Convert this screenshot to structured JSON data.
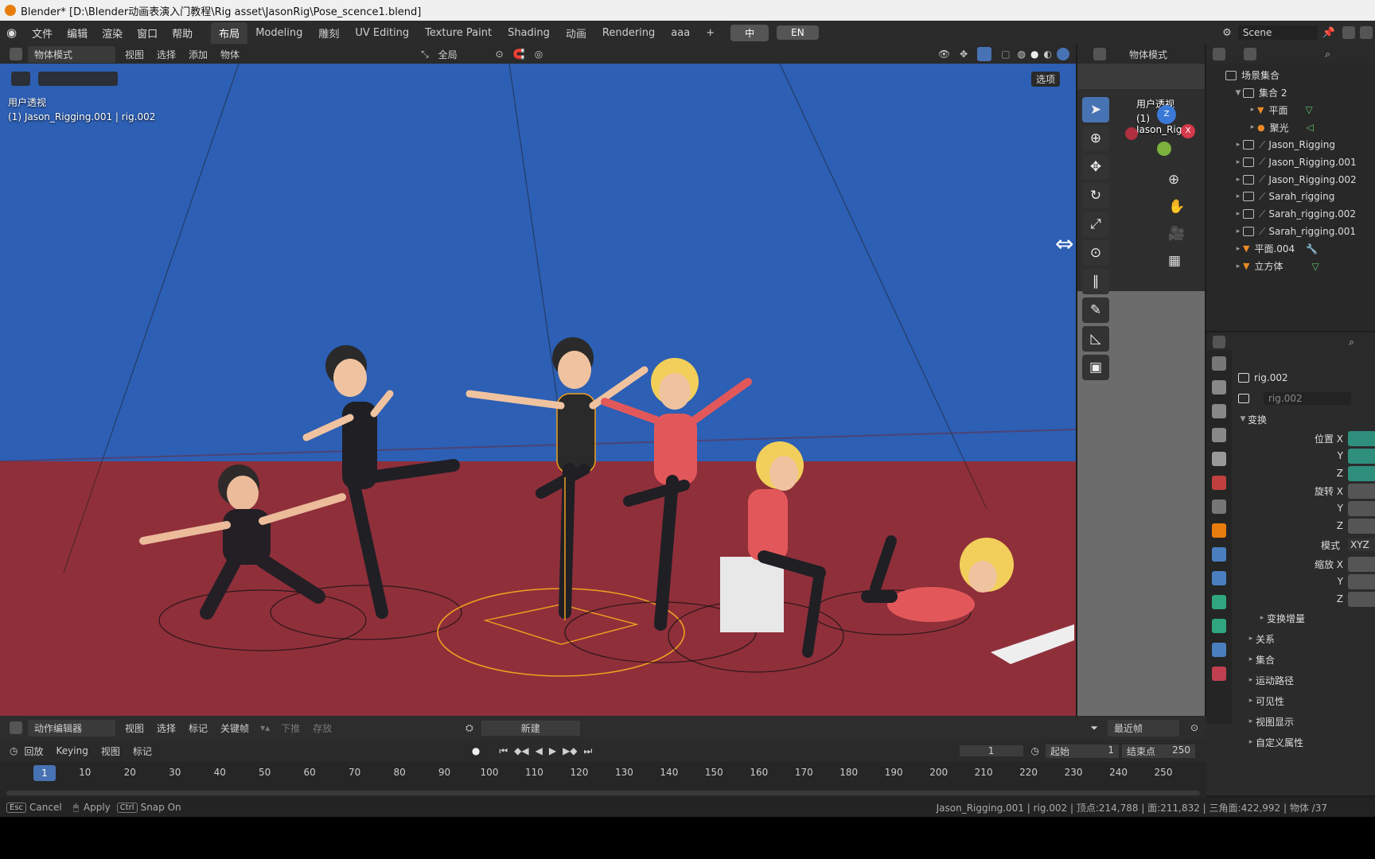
{
  "window": {
    "title": "Blender* [D:\\Blender动画表演入门教程\\Rig asset\\JasonRig\\Pose_scence1.blend]"
  },
  "menu": [
    "文件",
    "编辑",
    "渲染",
    "窗口",
    "帮助"
  ],
  "workspaces": [
    "布局",
    "Modeling",
    "雕刻",
    "UV Editing",
    "Texture Paint",
    "Shading",
    "动画",
    "Rendering",
    "aaa",
    "+"
  ],
  "lang_buttons": [
    "中",
    "EN"
  ],
  "scene": {
    "name": "Scene"
  },
  "viewport_header": {
    "mode": "物体模式",
    "menus": [
      "视图",
      "选择",
      "添加",
      "物体"
    ],
    "transform_orientation": "全局",
    "options_label": "选项"
  },
  "viewport": {
    "perspective_label": "用户透视",
    "object_label": "(1) Jason_Rigging.001 | rig.002"
  },
  "side_viewport": {
    "mode": "物体模式",
    "perspective_label": "用户透视",
    "object_label": "(1) Jason_Riggi",
    "gizmo": {
      "z": "Z",
      "x": "X"
    }
  },
  "outliner": {
    "root": "场景集合",
    "items": [
      {
        "label": "集合 2",
        "depth": 1,
        "type": "collection"
      },
      {
        "label": "平面",
        "depth": 2,
        "type": "mesh"
      },
      {
        "label": "聚光",
        "depth": 2,
        "type": "light"
      },
      {
        "label": "Jason_Rigging",
        "depth": 1,
        "type": "collection"
      },
      {
        "label": "Jason_Rigging.001",
        "depth": 1,
        "type": "collection"
      },
      {
        "label": "Jason_Rigging.002",
        "depth": 1,
        "type": "collection"
      },
      {
        "label": "Sarah_rigging",
        "depth": 1,
        "type": "collection"
      },
      {
        "label": "Sarah_rigging.002",
        "depth": 1,
        "type": "collection"
      },
      {
        "label": "Sarah_rigging.001",
        "depth": 1,
        "type": "collection"
      },
      {
        "label": "平面.004",
        "depth": 1,
        "type": "mesh"
      },
      {
        "label": "立方体",
        "depth": 1,
        "type": "mesh"
      }
    ]
  },
  "properties": {
    "object_name": "rig.002",
    "data_name": "rig.002",
    "transform_label": "变换",
    "location_labels": [
      "位置 X",
      "Y",
      "Z"
    ],
    "rotation_labels": [
      "旋转 X",
      "Y",
      "Z"
    ],
    "mode_label": "模式",
    "mode_value": "XYZ",
    "scale_labels": [
      "缩放 X",
      "Y",
      "Z"
    ],
    "delta_transform": "变换增量",
    "sections": [
      "关系",
      "集合",
      "运动路径",
      "可见性",
      "视图显示",
      "自定义属性"
    ]
  },
  "action_editor": {
    "editor_name": "动作编辑器",
    "menus": [
      "视图",
      "选择",
      "标记",
      "关键帧"
    ],
    "push_down": "下推",
    "stash": "存放",
    "new_label": "新建",
    "nearest_frame": "最近帧"
  },
  "timeline": {
    "playback": "回放",
    "keying": "Keying",
    "menus": [
      "视图",
      "标记"
    ],
    "current_frame": "1",
    "start_label": "起始",
    "start_value": "1",
    "end_label": "结束点",
    "end_value": "250",
    "current_marker": "1",
    "ticks": [
      "10",
      "20",
      "30",
      "40",
      "50",
      "60",
      "70",
      "80",
      "90",
      "100",
      "110",
      "120",
      "130",
      "140",
      "150",
      "160",
      "170",
      "180",
      "190",
      "200",
      "210",
      "220",
      "230",
      "240",
      "250"
    ]
  },
  "status_bar": {
    "esc_key": "Esc",
    "cancel": "Cancel",
    "apply": "Apply",
    "ctrl_key": "Ctrl",
    "snap": "Snap On",
    "stats": "Jason_Rigging.001 | rig.002 | 顶点:214,788 | 面:211,832 | 三角面:422,992 | 物体 /37"
  },
  "colors": {
    "wall": "#2d5fb4",
    "floor": "#8f2f3a",
    "selection_orange": "#f0a020",
    "active_blue": "#4772b3",
    "field_teal": "#2f8f7d"
  }
}
